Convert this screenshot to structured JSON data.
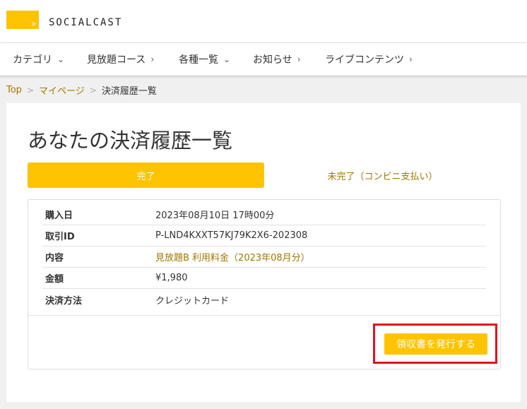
{
  "brand": {
    "mark": ">",
    "name": "SOCIALCAST"
  },
  "nav": [
    {
      "label": "カテゴリ",
      "chevron": "⌄"
    },
    {
      "label": "見放題コース",
      "chevron": "›"
    },
    {
      "label": "各種一覧",
      "chevron": "⌄"
    },
    {
      "label": "お知らせ",
      "chevron": "›"
    },
    {
      "label": "ライブコンテンツ",
      "chevron": "›"
    }
  ],
  "breadcrumb": {
    "home": "Top",
    "mypage": "マイページ",
    "current": "決済履歴一覧",
    "separator": ">"
  },
  "page": {
    "title": "あなたの決済履歴一覧"
  },
  "tabs": {
    "completed": "完了",
    "pending": "未完了（コンビニ支払い）"
  },
  "details": [
    {
      "label": "購入日",
      "value": "2023年08月10日 17時00分"
    },
    {
      "label": "取引ID",
      "value": "P-LND4KXXT57KJ79K2X6-202308"
    },
    {
      "label": "内容",
      "value": "見放題B 利用料金（2023年08月分）"
    },
    {
      "label": "金額",
      "value": "¥1,980"
    },
    {
      "label": "決済方法",
      "value": "クレジットカード"
    }
  ],
  "actions": {
    "receipt": "領収書を発行する"
  },
  "colors": {
    "accent": "#ffc300",
    "link": "#a07800",
    "highlight": "#e0141e",
    "background": "#f0f0f0"
  }
}
